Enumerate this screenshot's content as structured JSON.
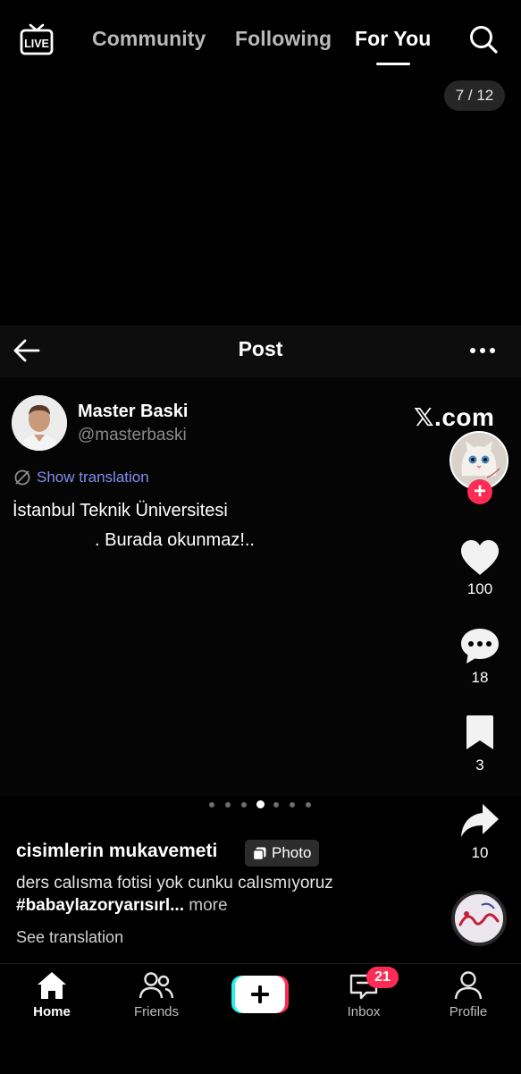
{
  "top_nav": {
    "live_label": "LIVE",
    "tabs": [
      {
        "label": "Community",
        "active": false
      },
      {
        "label": "Following",
        "active": false
      },
      {
        "label": "For You",
        "active": true
      }
    ],
    "search_icon": "search-icon"
  },
  "photo_counter": "7 / 12",
  "embedded_post": {
    "header_title": "Post",
    "author_name": "Master Baski",
    "author_handle": "@masterbaski",
    "source_label": "𝕏.com",
    "show_translation": "Show translation",
    "text_line1": "İstanbul Teknik Üniversitesi",
    "text_line2": ". Burada okunmaz!.."
  },
  "carousel": {
    "total_dots": 7,
    "active_index": 3
  },
  "right_rail": {
    "follow_plus": "+",
    "likes": "100",
    "comments": "18",
    "saves": "3",
    "shares": "10"
  },
  "caption": {
    "title": "cisimlerin mukavemeti",
    "photo_badge": "Photo",
    "desc_text": "ders calısma fotisi yok cunku calısmıyoruz ",
    "hashtag": "#babaylazoryarısırl...",
    "more": " more",
    "see_translation": "See translation"
  },
  "bottom_nav": {
    "home": "Home",
    "friends": "Friends",
    "inbox": "Inbox",
    "inbox_badge": "21",
    "profile": "Profile"
  },
  "colors": {
    "accent": "#fe2c55",
    "cyan": "#25f4ee",
    "link_blue": "#7f8ff0"
  }
}
